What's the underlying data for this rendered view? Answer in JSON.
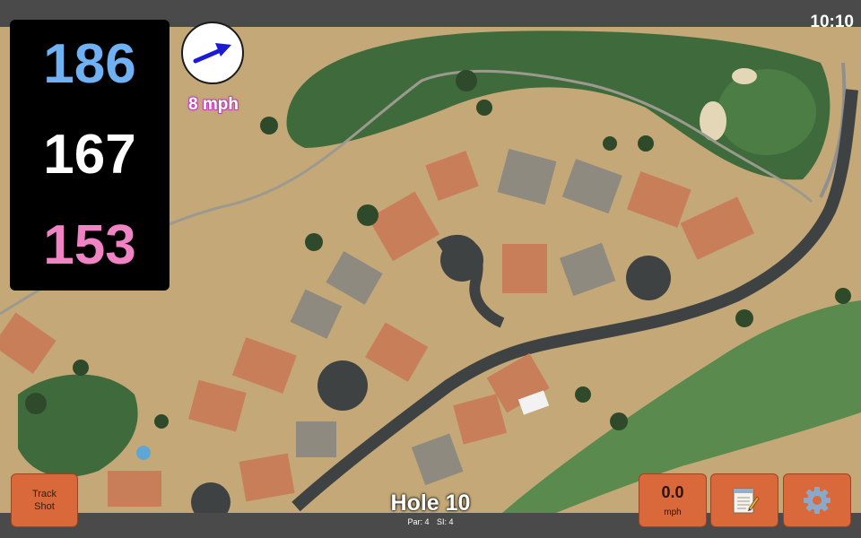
{
  "status_bar": {
    "time": "10:10"
  },
  "yardages": {
    "back": "186",
    "middle": "167",
    "front": "153"
  },
  "wind": {
    "speed_label": "8 mph",
    "icon": "wind-direction-arrow-icon",
    "direction": "east-northeast"
  },
  "buttons": {
    "track_shot_line1": "Track",
    "track_shot_line2": "Shot",
    "speed_value": "0.0",
    "speed_unit": "mph",
    "notes_icon": "notepad-icon",
    "settings_icon": "gear-icon"
  },
  "hole": {
    "title": "Hole 10",
    "par_label": "Par: 4",
    "si_label": "SI: 4"
  },
  "colors": {
    "back_yardage": "#6fb1f3",
    "middle_yardage": "#ffffff",
    "front_yardage": "#f083c4",
    "button": "#d9693a",
    "wind_label_outline": "#c043b7"
  }
}
